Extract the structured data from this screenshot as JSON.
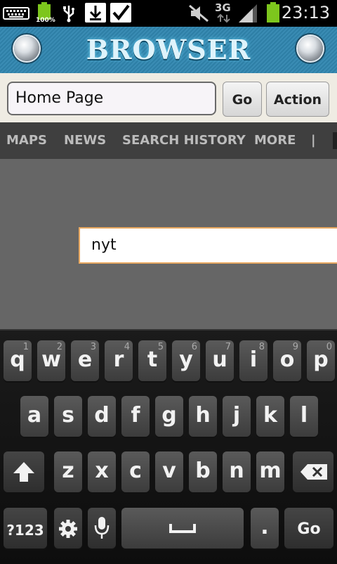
{
  "status_bar": {
    "battery_percent": "100%",
    "network_type": "3G",
    "time": "23:13"
  },
  "header": {
    "title": "BROWSER"
  },
  "url_bar": {
    "address_value": "Home Page",
    "go_label": "Go",
    "action_label": "Action"
  },
  "nav": {
    "items": [
      "MAPS",
      "NEWS",
      "SEARCH HISTORY",
      "MORE"
    ],
    "separator": "|"
  },
  "search": {
    "value": "nyt"
  },
  "keyboard": {
    "row1": [
      {
        "letter": "q",
        "number": "1"
      },
      {
        "letter": "w",
        "number": "2"
      },
      {
        "letter": "e",
        "number": "3"
      },
      {
        "letter": "r",
        "number": "4"
      },
      {
        "letter": "t",
        "number": "5"
      },
      {
        "letter": "y",
        "number": "6"
      },
      {
        "letter": "u",
        "number": "7"
      },
      {
        "letter": "i",
        "number": "8"
      },
      {
        "letter": "o",
        "number": "9"
      },
      {
        "letter": "p",
        "number": "0"
      }
    ],
    "row2": [
      "a",
      "s",
      "d",
      "f",
      "g",
      "h",
      "j",
      "k",
      "l"
    ],
    "row3": [
      "z",
      "x",
      "c",
      "v",
      "b",
      "n",
      "m"
    ],
    "symbols_label": "?123",
    "go_label": "Go",
    "period": "."
  },
  "colors": {
    "header_blue": "#2e7fa6",
    "battery_green": "#7dc61d",
    "search_border": "#e8a860"
  }
}
